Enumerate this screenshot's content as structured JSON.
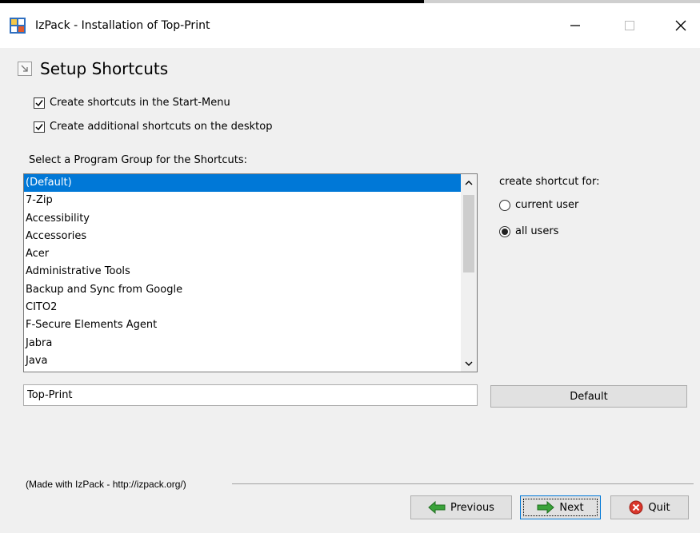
{
  "window": {
    "title": "IzPack - Installation of  Top-Print",
    "minimize_glyph": "—",
    "maximize_glyph": "☐",
    "close_glyph": "✕"
  },
  "panel": {
    "title": "Setup Shortcuts",
    "checkbox_start_menu": "Create shortcuts in the Start-Menu",
    "checkbox_desktop": "Create additional shortcuts on the desktop",
    "checkbox_start_menu_checked": true,
    "checkbox_desktop_checked": true,
    "select_group_label": "Select a Program Group for the Shortcuts:",
    "program_groups": [
      "(Default)",
      "7-Zip",
      "Accessibility",
      "Accessories",
      "Acer",
      "Administrative Tools",
      "Backup and Sync from Google",
      "CITO2",
      "F-Secure Elements Agent",
      "Jabra",
      "Java"
    ],
    "selected_group": "(Default)",
    "create_shortcut_for_label": "create shortcut for:",
    "radio_current_user": "current user",
    "radio_all_users": "all users",
    "selected_radio": "all users",
    "group_name_value": "Top-Print",
    "default_button": "Default"
  },
  "footer": {
    "made_with": "(Made with IzPack - http://izpack.org/)",
    "previous_button": "Previous",
    "next_button": "Next",
    "quit_button": "Quit"
  },
  "colors": {
    "selection": "#0078d7",
    "arrow_green": "#3aa33a",
    "quit_red": "#d9362b"
  }
}
